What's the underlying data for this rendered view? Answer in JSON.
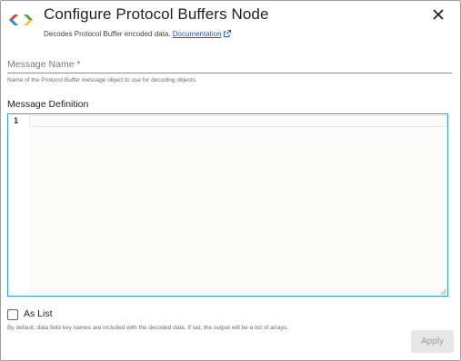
{
  "dialog": {
    "title": "Configure Protocol Buffers Node",
    "subtitle_text": "Decodes Protocol Buffer encoded data.",
    "documentation_link": "Documentation"
  },
  "fields": {
    "message_name": {
      "placeholder": "Message Name *",
      "value": "",
      "helper": "Name of the Protocol Buffer message object to use for decoding objects."
    },
    "message_definition": {
      "label": "Message Definition",
      "line_number": "1",
      "value": ""
    },
    "as_list": {
      "label": "As List",
      "checked": false,
      "helper": "By default, data field key names are included with the decoded data. If set, the output will be a list of arrays."
    }
  },
  "buttons": {
    "apply": "Apply"
  },
  "icons": {
    "logo": "protocol-buffers-logo-icon",
    "close": "close-icon",
    "external_link": "external-link-icon",
    "resize": "resize-handle-icon"
  },
  "colors": {
    "link": "#1a56c8",
    "editor_border": "#2c9ed9",
    "logo_red": "#e53935",
    "logo_blue": "#1e88e5",
    "logo_green": "#43a047",
    "logo_yellow": "#fbc02d"
  }
}
